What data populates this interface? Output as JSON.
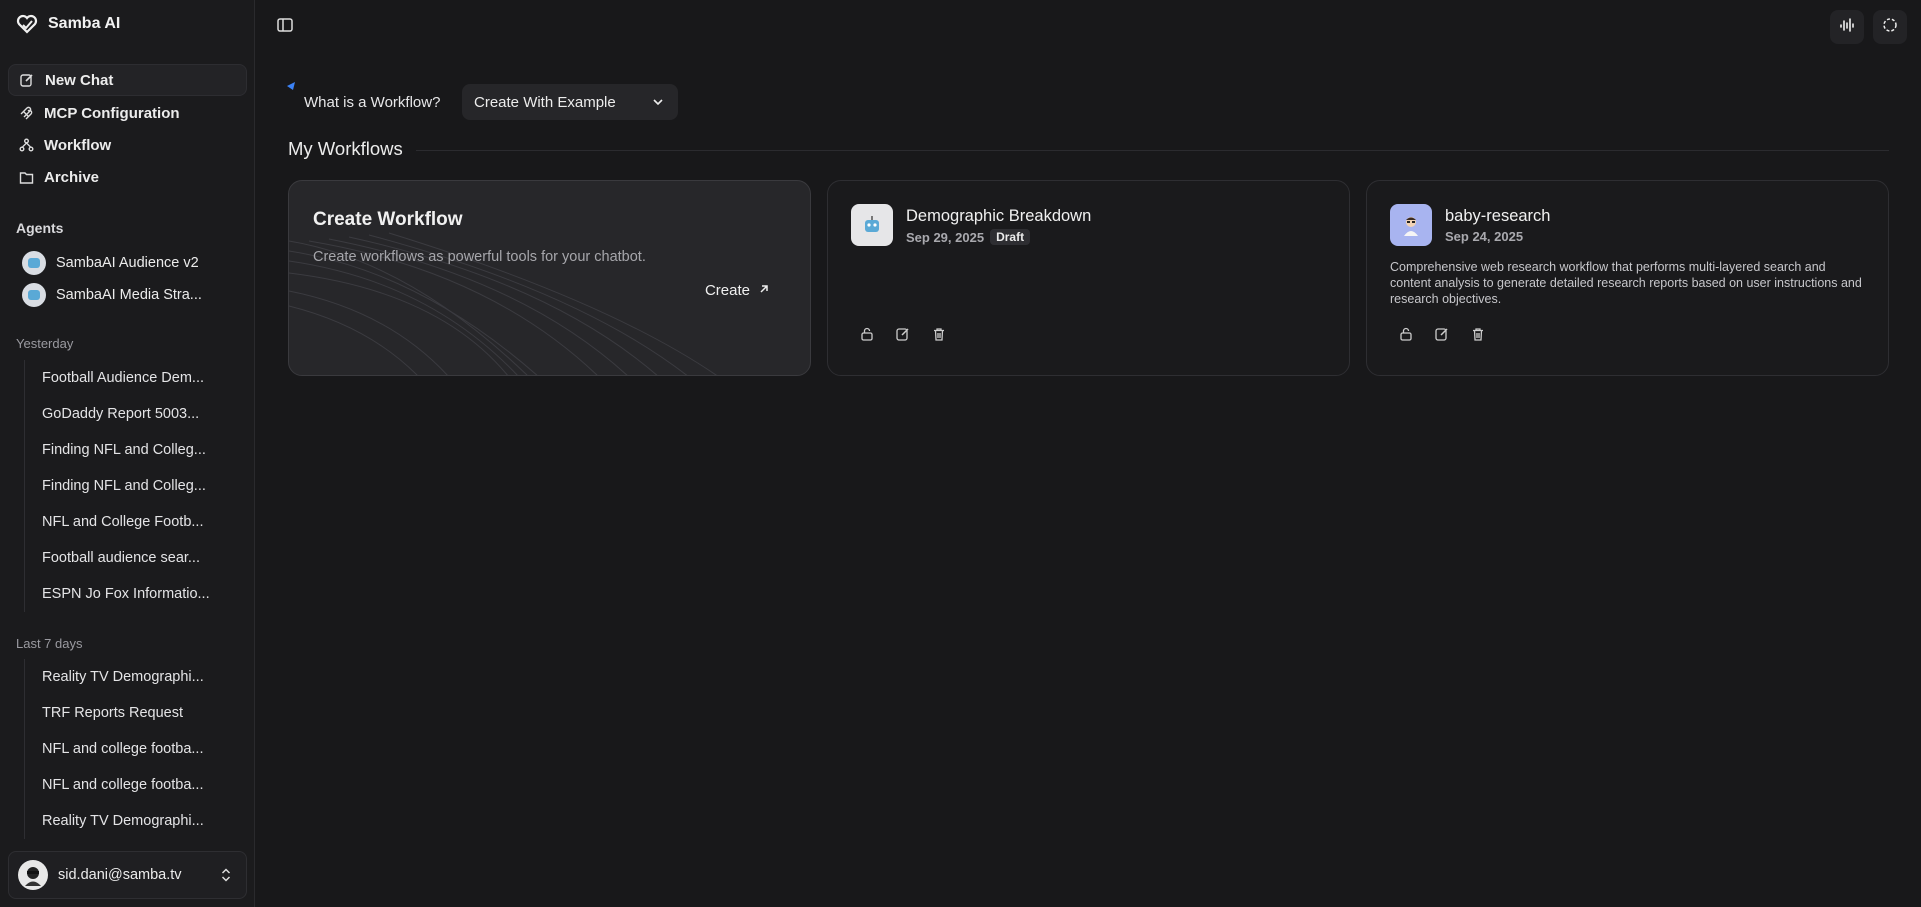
{
  "app": {
    "name": "Samba AI"
  },
  "nav": [
    {
      "label": "New Chat",
      "icon": "edit-icon"
    },
    {
      "label": "MCP Configuration",
      "icon": "mcp-icon"
    },
    {
      "label": "Workflow",
      "icon": "workflow-icon"
    },
    {
      "label": "Archive",
      "icon": "archive-icon"
    }
  ],
  "agents": {
    "label": "Agents",
    "items": [
      {
        "name": "SambaAI Audience v2"
      },
      {
        "name": "SambaAI Media Stra..."
      }
    ]
  },
  "history": {
    "yesterday_label": "Yesterday",
    "yesterday": [
      "Football Audience Dem...",
      "GoDaddy Report 5003...",
      "Finding NFL and Colleg...",
      "Finding NFL and Colleg...",
      "NFL and College Footb...",
      "Football audience sear...",
      "ESPN Jo Fox Informatio..."
    ],
    "last7_label": "Last 7 days",
    "last7": [
      "Reality TV Demographi...",
      "TRF Reports Request",
      "NFL and college footba...",
      "NFL and college footba...",
      "Reality TV Demographi..."
    ]
  },
  "user": {
    "email": "sid.dani@samba.tv"
  },
  "main": {
    "what_is": "What is a Workflow?",
    "create_select": "Create With Example",
    "section_title": "My Workflows",
    "create_card": {
      "title": "Create Workflow",
      "desc": "Create workflows as powerful tools for your chatbot.",
      "button": "Create"
    },
    "workflows": [
      {
        "title": "Demographic Breakdown",
        "date": "Sep 29, 2025",
        "badge": "Draft",
        "desc": "",
        "icon_bg": "#e6e6e8"
      },
      {
        "title": "baby-research",
        "date": "Sep 24, 2025",
        "badge": "",
        "desc": "Comprehensive web research workflow that performs multi-layered search and content analysis to generate detailed research reports based on user instructions and research objectives.",
        "icon_bg": "#a8b4f0"
      }
    ]
  }
}
